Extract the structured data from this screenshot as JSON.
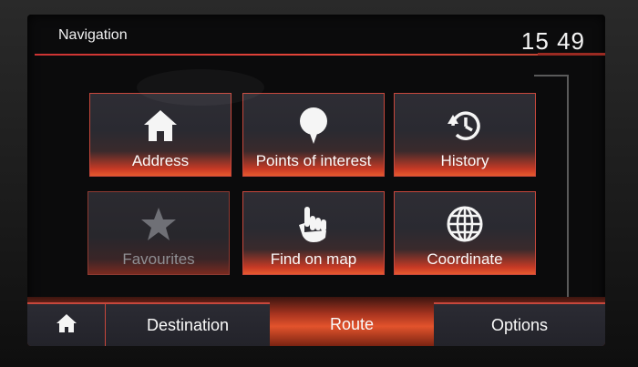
{
  "header": {
    "title": "Navigation",
    "clock": "15 49"
  },
  "menu": {
    "tiles": [
      {
        "label": "Address",
        "icon": "home-icon"
      },
      {
        "label": "Points of interest",
        "icon": "map-pin-icon"
      },
      {
        "label": "History",
        "icon": "history-icon"
      },
      {
        "label": "Favourites",
        "icon": "star-icon"
      },
      {
        "label": "Find on map",
        "icon": "hand-pointer-icon"
      },
      {
        "label": "Coordinate",
        "icon": "globe-icon"
      }
    ]
  },
  "tabs": {
    "home_icon": "home-icon",
    "destination": "Destination",
    "route": "Route",
    "options": "Options"
  },
  "colors": {
    "accent": "#e6473a",
    "tile_bg": "#2e2d34",
    "disabled_text": "#8f8f93"
  }
}
